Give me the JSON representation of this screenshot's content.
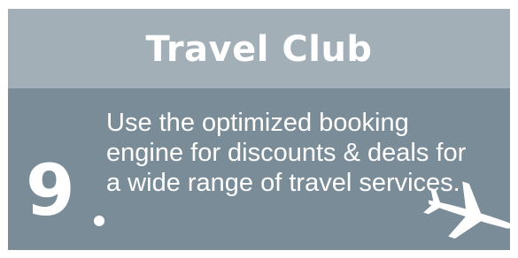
{
  "card": {
    "title": "Travel Club",
    "number": "9",
    "description": "Use the optimized booking engine for discounts & deals for a wide range of travel services."
  },
  "icons": {
    "plane": "airplane-icon"
  },
  "colors": {
    "header_bg": "#a2afb6",
    "body_bg": "#7a8c97",
    "text": "#ffffff"
  }
}
